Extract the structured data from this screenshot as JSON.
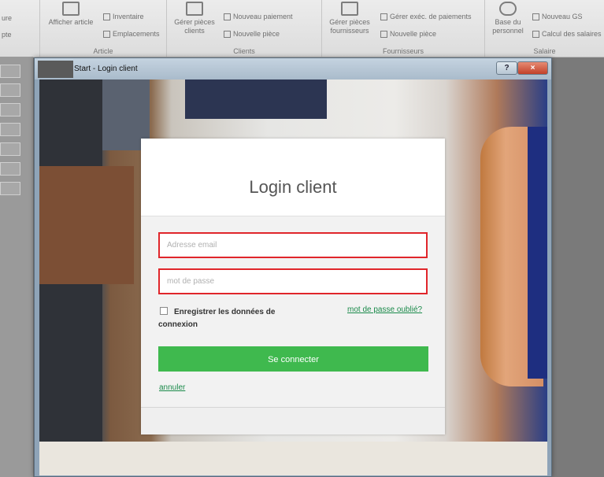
{
  "ribbon": {
    "left_partial_1": "ure",
    "left_partial_2": "pte",
    "article": {
      "show_item": "Afficher article",
      "inventory": "Inventaire",
      "locations": "Emplacements",
      "group_label": "Article"
    },
    "clients": {
      "manage_docs_line1": "Gérer pièces",
      "manage_docs_line2": "clients",
      "new_payment": "Nouveau paiement",
      "new_doc": "Nouvelle pièce",
      "group_label": "Clients"
    },
    "suppliers": {
      "manage_docs_line1": "Gérer pièces",
      "manage_docs_line2": "fournisseurs",
      "manage_payments": "Gérer exéc. de paiements",
      "new_doc": "Nouvelle pièce",
      "group_label": "Fournisseurs"
    },
    "salary": {
      "staff_line1": "Base du",
      "staff_line2": "personnel",
      "new_gs": "Nouveau GS",
      "calc": "Calcul des salaires",
      "group_label": "Salaire"
    }
  },
  "window": {
    "title": "Start - Login client",
    "help": "?",
    "close": "×"
  },
  "login": {
    "title": "Login client",
    "email_placeholder": "Adresse email",
    "password_placeholder": "mot de passe",
    "remember_label": "Enregistrer les données de connexion",
    "forgot_link": "mot de passe oublié?",
    "submit": "Se connecter",
    "cancel": "annuler"
  }
}
